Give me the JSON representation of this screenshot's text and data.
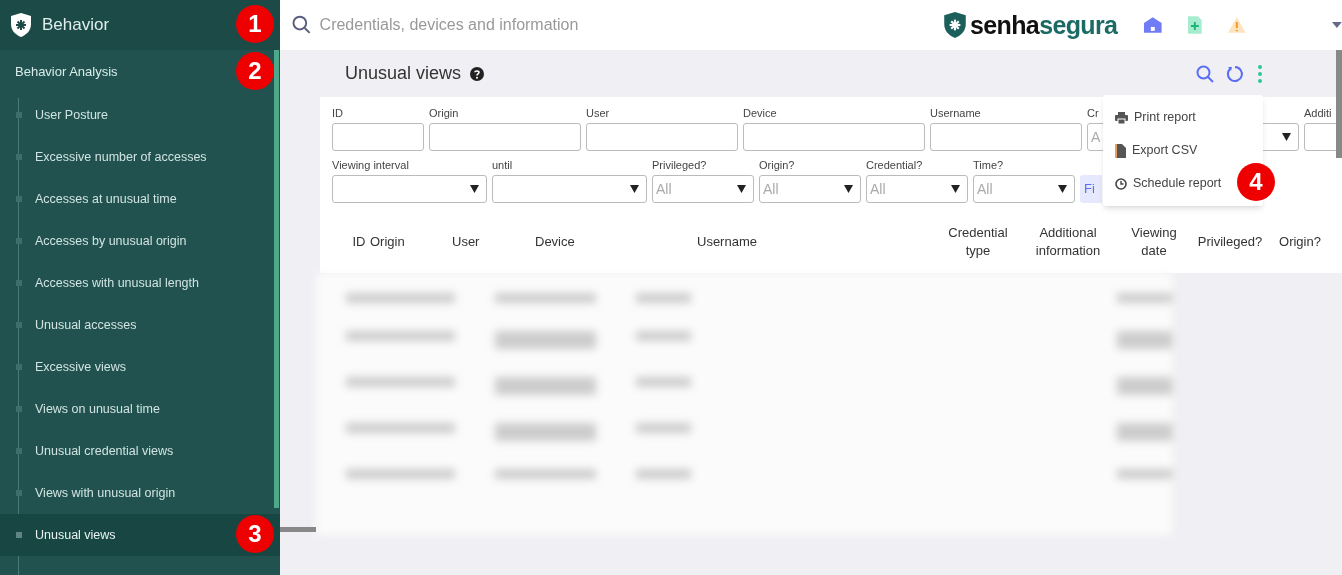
{
  "header": {
    "title": "Behavior",
    "search": {
      "placeholder": "Credentials, devices and information"
    },
    "brand": [
      "senha",
      "segura"
    ]
  },
  "sidebar": {
    "section": "Behavior Analysis",
    "items": [
      {
        "label": "User Posture",
        "selected": false
      },
      {
        "label": "Excessive number of accesses",
        "selected": false
      },
      {
        "label": "Accesses at unusual time",
        "selected": false
      },
      {
        "label": "Accesses by unusual origin",
        "selected": false
      },
      {
        "label": "Accesses with unusual length",
        "selected": false
      },
      {
        "label": "Unusual accesses",
        "selected": false
      },
      {
        "label": "Excessive views",
        "selected": false
      },
      {
        "label": "Views on unusual time",
        "selected": false
      },
      {
        "label": "Unusual credential views",
        "selected": false
      },
      {
        "label": "Views with unusual origin",
        "selected": false
      },
      {
        "label": "Unusual views",
        "selected": true
      }
    ]
  },
  "page": {
    "title": "Unusual views"
  },
  "filters": [
    [
      {
        "kind": "text",
        "label": "ID"
      },
      {
        "kind": "text",
        "label": "Origin"
      },
      {
        "kind": "text",
        "label": "User"
      },
      {
        "kind": "text",
        "label": "Device"
      },
      {
        "kind": "text",
        "label": "Username"
      },
      {
        "kind": "select",
        "label": "Cr",
        "value": "A"
      },
      {
        "kind": "text",
        "label": "Additi"
      }
    ],
    [
      {
        "kind": "select",
        "label": "Viewing interval"
      },
      {
        "kind": "select",
        "label": "until"
      },
      {
        "kind": "select",
        "label": "Privileged?",
        "value": "All"
      },
      {
        "kind": "select",
        "label": "Origin?",
        "value": "All"
      },
      {
        "kind": "select",
        "label": "Credential?",
        "value": "All"
      },
      {
        "kind": "select",
        "label": "Time?",
        "value": "All"
      },
      {
        "kind": "button",
        "label": "Fi"
      }
    ]
  ],
  "table": {
    "columns": [
      "ID",
      "Origin",
      "User",
      "Device",
      "Username",
      "Credential type",
      "Additional information",
      "Viewing date",
      "Privileged?",
      "Origin?"
    ]
  },
  "menu": [
    {
      "kind": "print",
      "label": "Print report"
    },
    {
      "kind": "file",
      "label": "Export CSV"
    },
    {
      "kind": "clock",
      "label": "Schedule report"
    }
  ],
  "annotations": [
    "1",
    "2",
    "3",
    "4"
  ]
}
